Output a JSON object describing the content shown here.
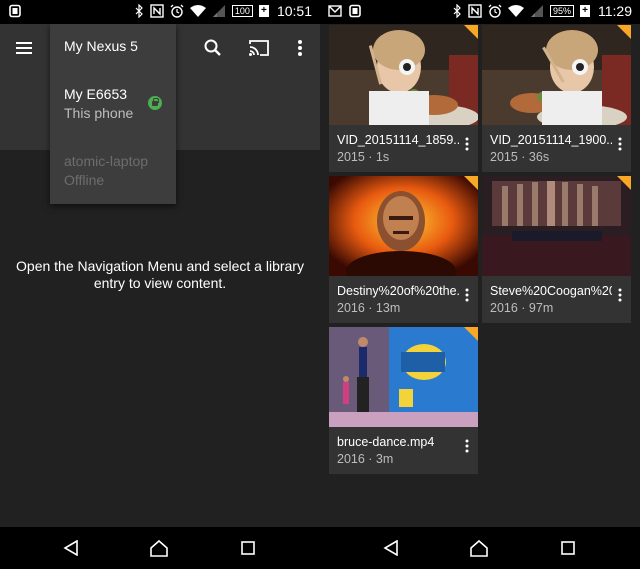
{
  "left_screen": {
    "status": {
      "battery": "100",
      "time": "10:51"
    },
    "appbar": {
      "menu_icon": "hamburger-menu-icon",
      "search_icon": "search-icon",
      "cast_icon": "cast-icon",
      "more_icon": "more-vert-icon"
    },
    "dropdown": {
      "items": [
        {
          "title": "My Nexus 5",
          "subtitle": ""
        },
        {
          "title": "My E6653",
          "subtitle": "This phone",
          "locked": true
        },
        {
          "title": "atomic-laptop",
          "subtitle": "Offline",
          "disabled": true
        }
      ]
    },
    "empty_message": "Open the Navigation Menu and select a library entry to view content."
  },
  "right_screen": {
    "status": {
      "battery": "95%",
      "time": "11:29"
    },
    "videos": [
      {
        "title": "VID_20151114_1859...",
        "meta": "2015 · 1s"
      },
      {
        "title": "VID_20151114_1900...",
        "meta": "2015 · 36s"
      },
      {
        "title": "Destiny%20of%20the...",
        "meta": "2016 · 13m"
      },
      {
        "title": "Steve%20Coogan%20...",
        "meta": "2016 · 97m"
      },
      {
        "title": "bruce-dance.mp4",
        "meta": "2016 · 3m"
      }
    ]
  },
  "nav_icons": [
    "back-icon",
    "home-icon",
    "recents-icon"
  ],
  "colors": {
    "accent_corner": "#f9a825",
    "lock_green": "#4caf50",
    "appbar": "#333333",
    "background": "#212121"
  }
}
